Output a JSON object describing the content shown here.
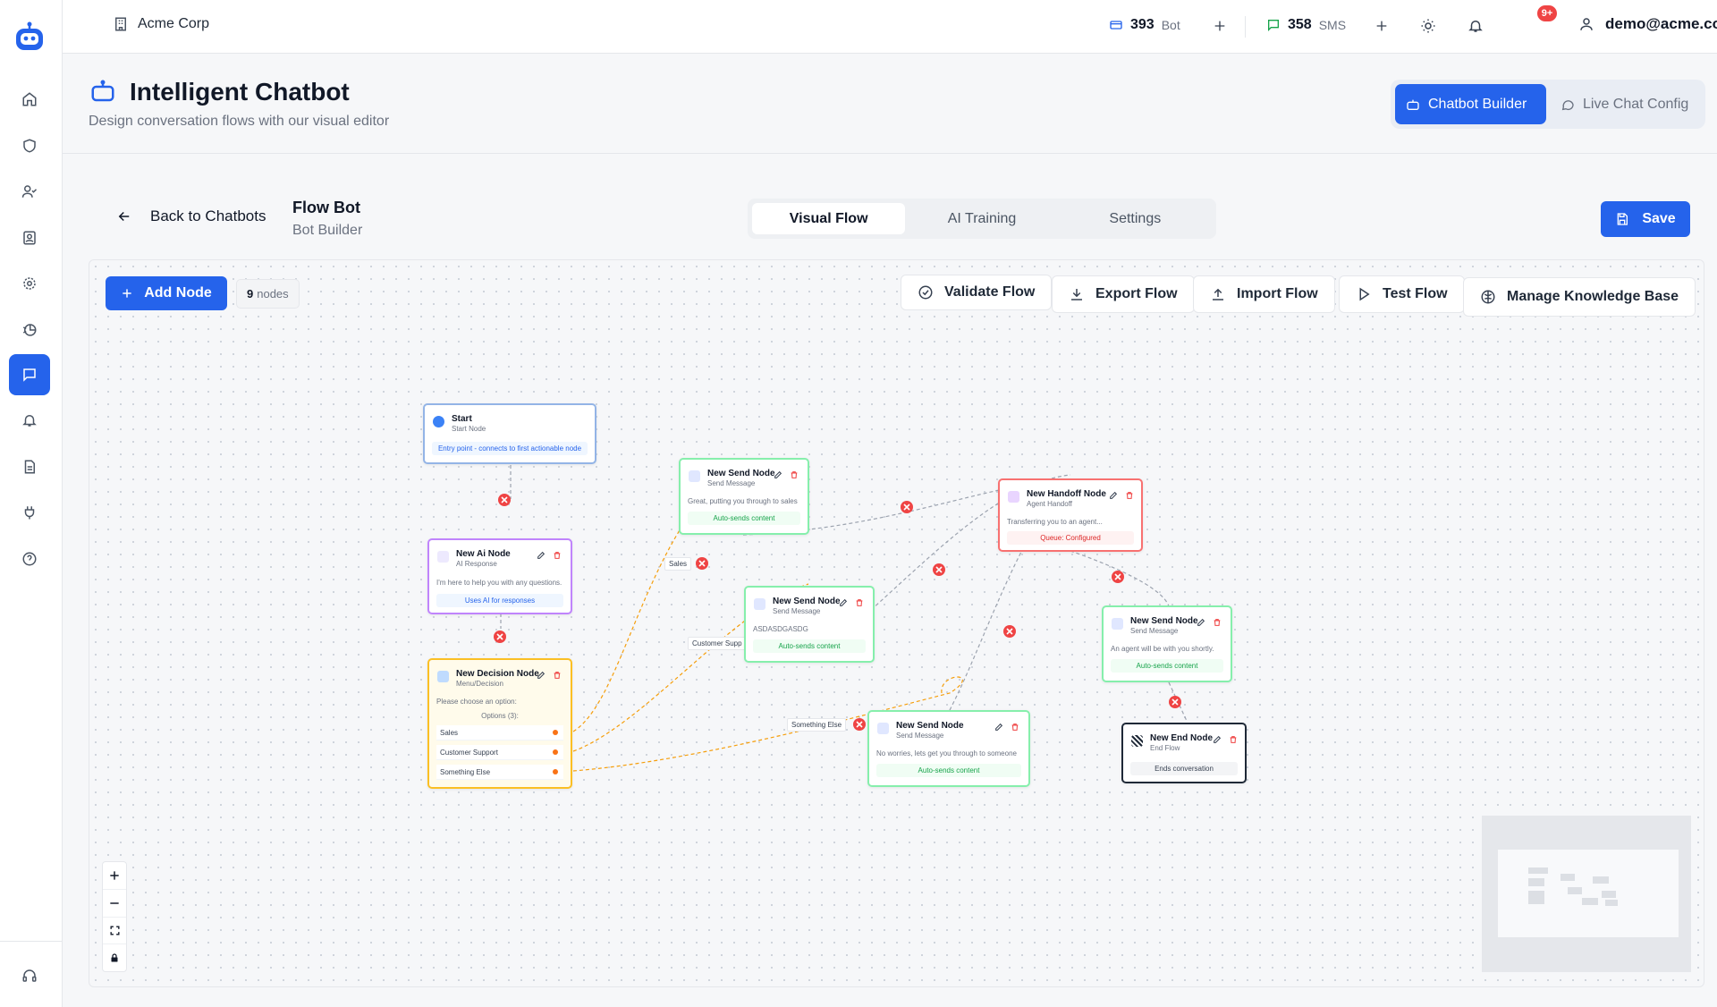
{
  "colors": {
    "primary": "#2563eb",
    "danger": "#ef4444",
    "success": "#16a34a",
    "warning": "#f59e0b",
    "purple": "#a855f7"
  },
  "sidebar": {
    "items": [
      {
        "name": "home-icon"
      },
      {
        "name": "shield-icon"
      },
      {
        "name": "user-check-icon"
      },
      {
        "name": "contact-card-icon"
      },
      {
        "name": "gear-icon"
      },
      {
        "name": "analytics-icon"
      },
      {
        "name": "chat-icon",
        "active": true
      },
      {
        "name": "bell-icon"
      },
      {
        "name": "document-icon"
      },
      {
        "name": "plug-icon"
      },
      {
        "name": "help-icon"
      },
      {
        "name": "headset-icon"
      }
    ]
  },
  "topbar": {
    "company": "Acme Corp",
    "bot_count": "393",
    "bot_unit": "Bot",
    "sms_count": "358",
    "sms_unit": "SMS",
    "notifications": "9+",
    "user_email": "demo@acme.com"
  },
  "page": {
    "title": "Intelligent Chatbot",
    "subtitle": "Design conversation flows with our visual editor",
    "mode_builder": "Chatbot Builder",
    "mode_livechat": "Live Chat Config"
  },
  "flow": {
    "back_label": "Back to Chatbots",
    "title": "Flow Bot",
    "subtitle": "Bot Builder",
    "tabs": [
      "Visual Flow",
      "AI Training",
      "Settings"
    ],
    "save_label": "Save"
  },
  "toolbar": {
    "add_node": "Add Node",
    "node_count": "9",
    "node_count_unit": "nodes",
    "validate": "Validate Flow",
    "export": "Export Flow",
    "import": "Import Flow",
    "test": "Test Flow",
    "knowledge": "Manage Knowledge Base"
  },
  "nodes": {
    "start": {
      "title": "Start",
      "type": "Start Node",
      "desc": "Entry point - connects to first actionable node"
    },
    "ai": {
      "title": "New Ai Node",
      "type": "AI Response",
      "desc": "I'm here to help you with any questions.",
      "pill": "Uses AI for responses"
    },
    "decision": {
      "title": "New Decision Node",
      "type": "Menu/Decision",
      "desc": "Please choose an option:",
      "options_label": "Options (3):",
      "options": [
        "Sales",
        "Customer Support",
        "Something Else"
      ]
    },
    "send1": {
      "title": "New Send Node",
      "type": "Send Message",
      "desc": "Great, putting you through to sales",
      "pill": "Auto-sends content"
    },
    "send2": {
      "title": "New Send Node",
      "type": "Send Message",
      "desc": "ASDASDGASDG",
      "pill": "Auto-sends content"
    },
    "send3": {
      "title": "New Send Node",
      "type": "Send Message",
      "desc": "No worries, lets get you through to someone",
      "pill": "Auto-sends content"
    },
    "handoff": {
      "title": "New Handoff Node",
      "type": "Agent Handoff",
      "desc": "Transferring you to an agent...",
      "pill": "Queue: Configured"
    },
    "send4": {
      "title": "New Send Node",
      "type": "Send Message",
      "desc": "An agent will be with you shortly.",
      "pill": "Auto-sends content"
    },
    "end": {
      "title": "New End Node",
      "type": "End Flow",
      "pill": "Ends conversation"
    }
  },
  "edge_labels": {
    "sales": "Sales",
    "support": "Customer Supp",
    "else": "Something Else"
  }
}
